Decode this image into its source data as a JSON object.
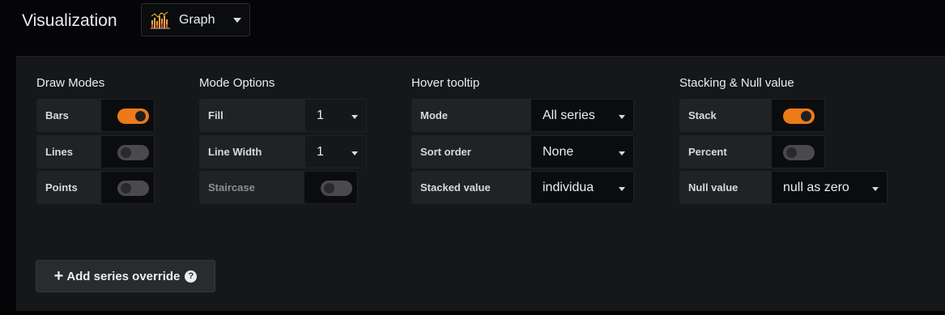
{
  "header": {
    "title": "Visualization",
    "picker": {
      "label": "Graph",
      "icon": "bar-graph-icon"
    }
  },
  "draw_modes": {
    "title": "Draw Modes",
    "rows": [
      {
        "label": "Bars",
        "enabled": true
      },
      {
        "label": "Lines",
        "enabled": false
      },
      {
        "label": "Points",
        "enabled": false
      }
    ]
  },
  "mode_options": {
    "title": "Mode Options",
    "fill": {
      "label": "Fill",
      "value": "1"
    },
    "line_width": {
      "label": "Line Width",
      "value": "1"
    },
    "staircase": {
      "label": "Staircase",
      "enabled": false
    }
  },
  "hover_tooltip": {
    "title": "Hover tooltip",
    "mode": {
      "label": "Mode",
      "value": "All series"
    },
    "sort_order": {
      "label": "Sort order",
      "value": "None"
    },
    "stacked_value": {
      "label": "Stacked value",
      "value": "individua"
    }
  },
  "stacking": {
    "title": "Stacking & Null value",
    "stack": {
      "label": "Stack",
      "enabled": true
    },
    "percent": {
      "label": "Percent",
      "enabled": false
    },
    "null_value": {
      "label": "Null value",
      "value": "null as zero"
    }
  },
  "add_override": {
    "label": "Add series override",
    "plus": "+",
    "help": "?"
  },
  "colors": {
    "accent": "#eb7b18",
    "background": "#050507",
    "panel": "#161719"
  }
}
